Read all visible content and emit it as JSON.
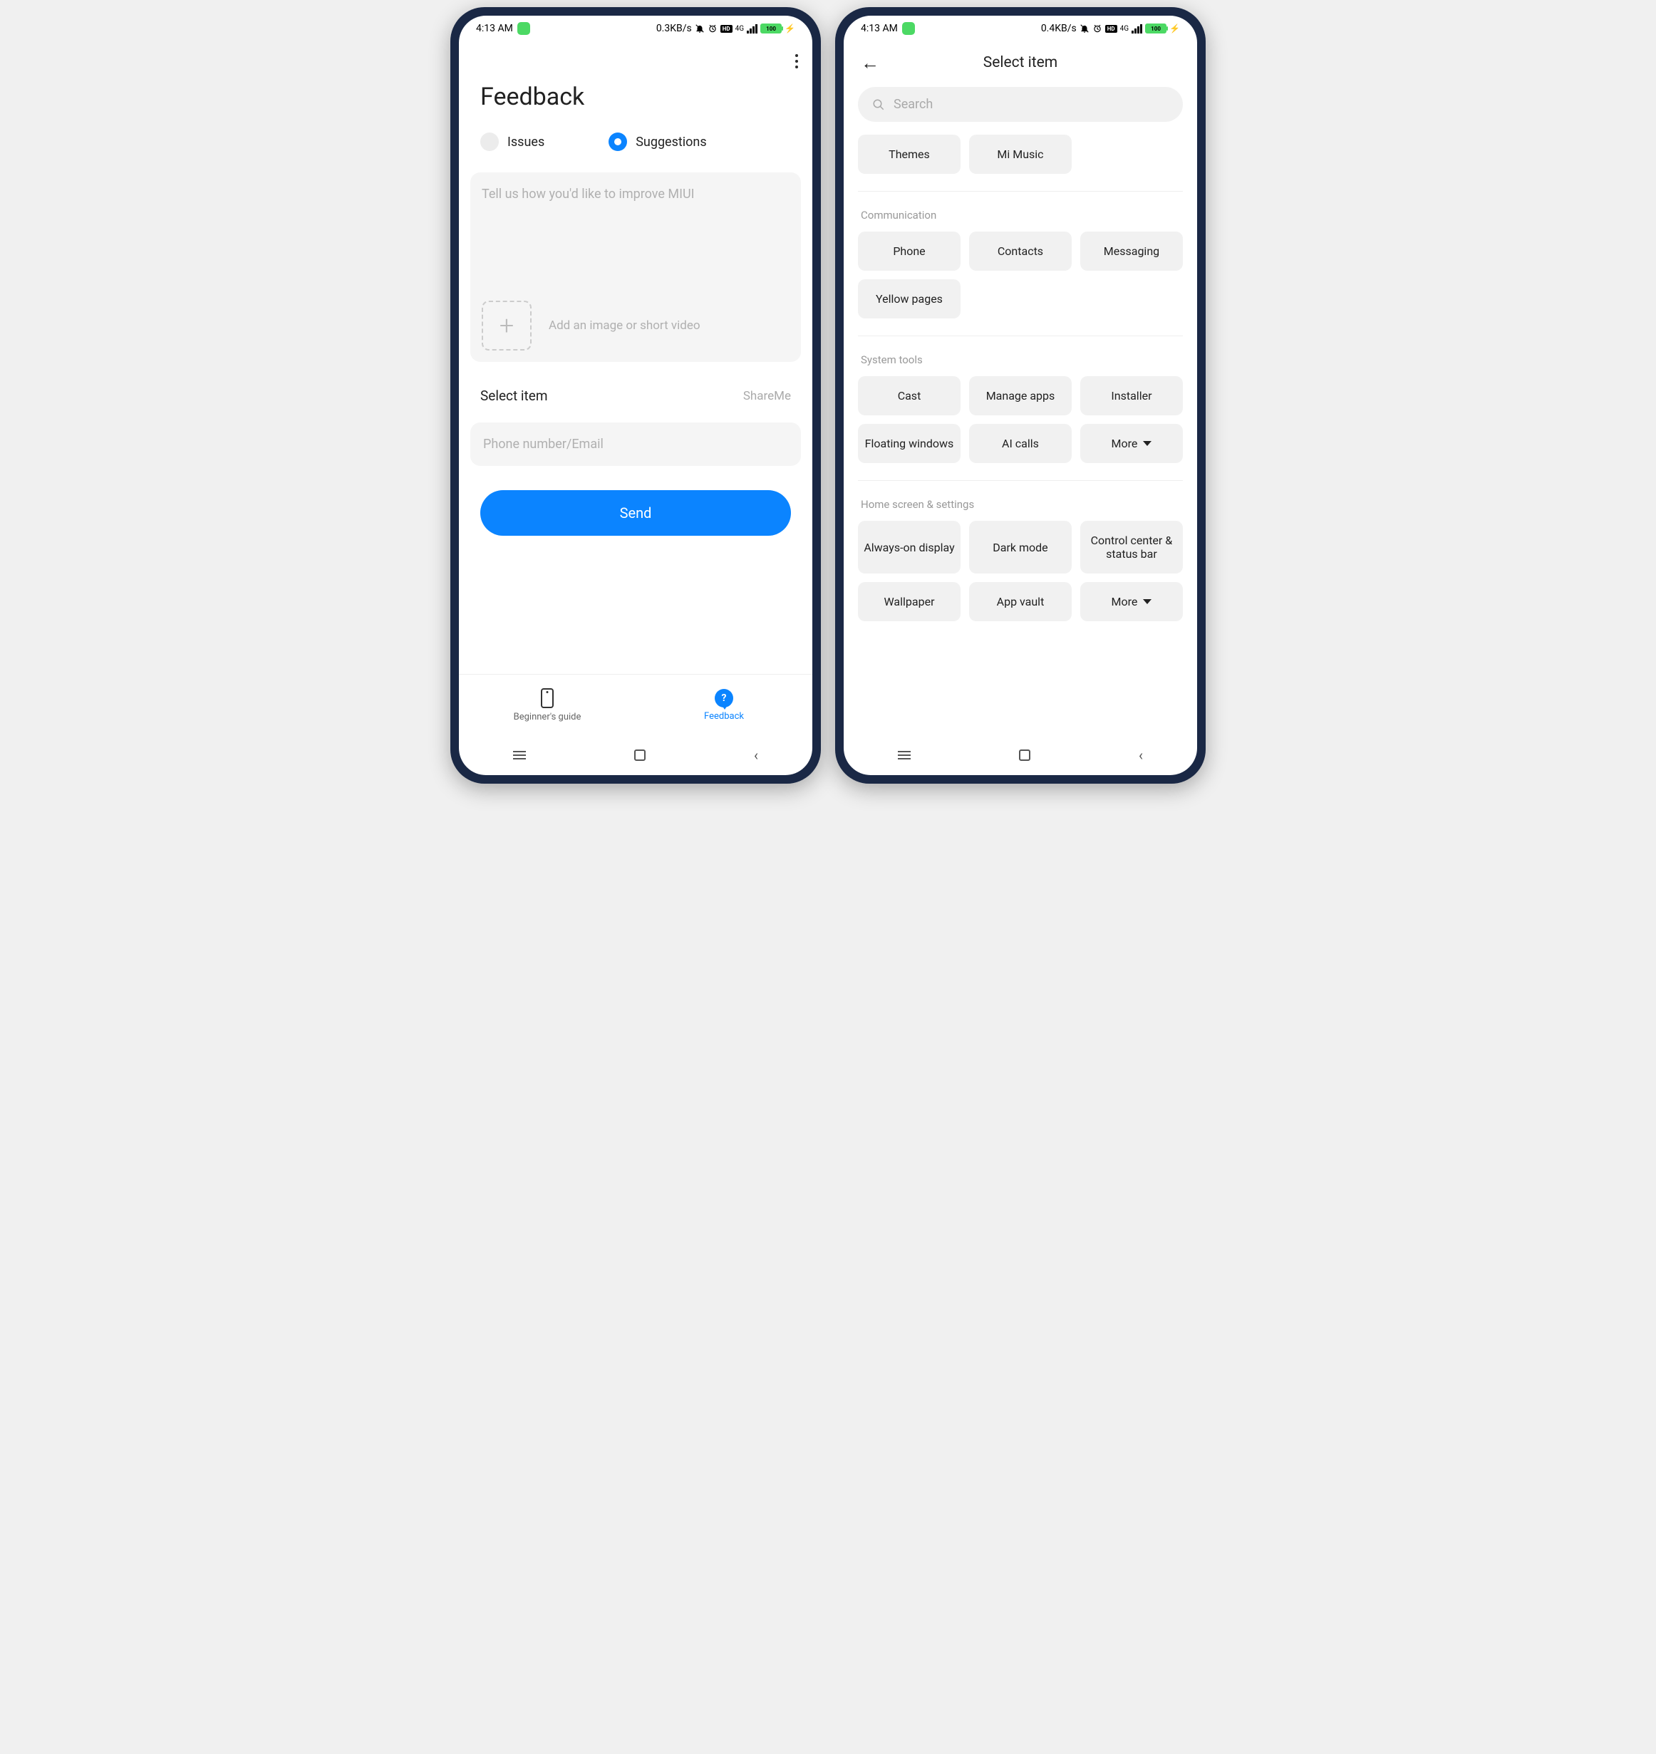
{
  "status1": {
    "time": "4:13 AM",
    "net": "0.3KB/s",
    "4g": "4G",
    "hd": "HD",
    "batt": "100"
  },
  "status2": {
    "time": "4:13 AM",
    "net": "0.4KB/s",
    "4g": "4G",
    "hd": "HD",
    "batt": "100"
  },
  "feedback": {
    "title": "Feedback",
    "radio1": "Issues",
    "radio2": "Suggestions",
    "textarea_placeholder": "Tell us how you'd like to improve MIUI",
    "attach_text": "Add an image or short video",
    "select_label": "Select item",
    "select_value": "ShareMe",
    "contact_placeholder": "Phone number/Email",
    "send": "Send",
    "tab1": "Beginner's guide",
    "tab2": "Feedback"
  },
  "select": {
    "title": "Select item",
    "search_placeholder": "Search",
    "top1": "Themes",
    "top2": "Mi Music",
    "sec_comm": "Communication",
    "comm1": "Phone",
    "comm2": "Contacts",
    "comm3": "Messaging",
    "comm4": "Yellow pages",
    "sec_sys": "System tools",
    "sys1": "Cast",
    "sys2": "Manage apps",
    "sys3": "Installer",
    "sys4": "Floating windows",
    "sys5": "AI calls",
    "sys_more": "More",
    "sec_home": "Home screen & settings",
    "home1": "Always-on display",
    "home2": "Dark mode",
    "home3": "Control center & status bar",
    "home4": "Wallpaper",
    "home5": "App vault",
    "home_more": "More"
  }
}
